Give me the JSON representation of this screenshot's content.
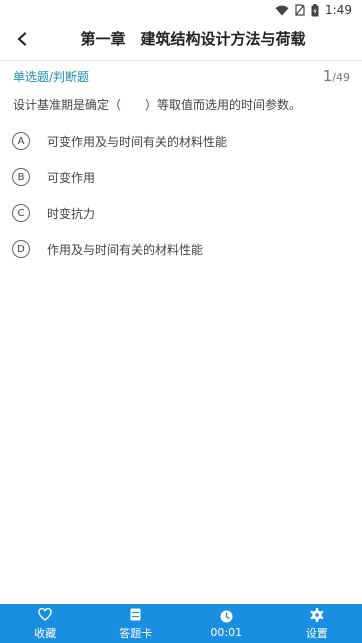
{
  "status": {
    "time": "1:49"
  },
  "header": {
    "title": "第一章　建筑结构设计方法与荷载"
  },
  "question": {
    "type": "单选题/判断题",
    "current": "1",
    "total": "/49",
    "stem": "设计基准期是确定（　　）等取值而选用的时间参数。",
    "options": [
      {
        "letter": "A",
        "text": "可变作用及与时间有关的材料性能"
      },
      {
        "letter": "B",
        "text": "可变作用"
      },
      {
        "letter": "C",
        "text": "时变抗力"
      },
      {
        "letter": "D",
        "text": "作用及与时间有关的材料性能"
      }
    ]
  },
  "bottom_bar": {
    "favorite": "收藏",
    "answer_card": "答题卡",
    "timer": "00:01",
    "settings": "设置"
  },
  "colors": {
    "accent": "#1a8ee0",
    "type_text": "#1a8fb5"
  }
}
